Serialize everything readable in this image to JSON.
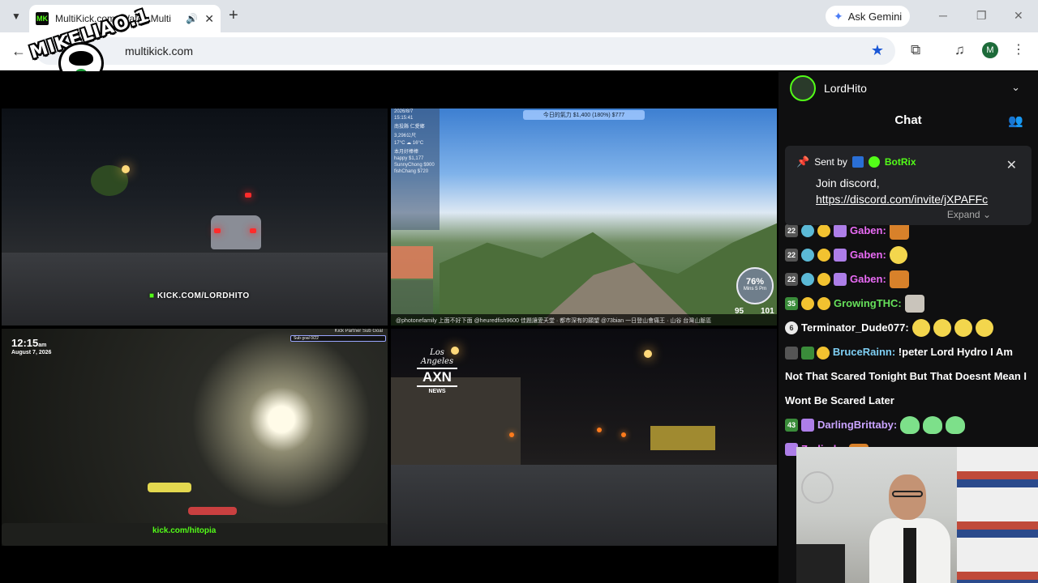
{
  "browser": {
    "tab_title": "MultiKick.com: Watch Multi",
    "tab_favicon": "MK",
    "new_tab": "+",
    "gemini_label": "Ask Gemini",
    "url": "multikick.com",
    "profile_initial": "M"
  },
  "overlay_logo": {
    "text": "MIKELIAO.1"
  },
  "streams": {
    "s1": {
      "watermark": "KICK.COM/LORDHITO"
    },
    "s2": {
      "banner": "今日的氣力   $1,400 (180%)    $777",
      "panel": [
        "2026/8/7",
        "15:15:41",
        "南投縣 仁愛鄉",
        "3,296公尺",
        "17°C ☁ 16°C",
        "本月好棒棒",
        "happy   $1,177",
        "SunnyChong   $900",
        "fishChang   $720"
      ],
      "gauge_pct": "76%",
      "gauge_sub": "Mins 5 Pm",
      "counter_left": "95",
      "counter_right": "101",
      "ticker": "@photonefamily 上面不好下面 @heuredfish9600 佳題讓愛天堂 · 都市深有的願望 @73bian 一日登山會痛王 · 山谷 台灣山脈區"
    },
    "s3": {
      "time": "12:15",
      "ampm": "am",
      "date": "August 7, 2026",
      "subgoal_title": "Kick Partner Sub Goal",
      "subgoal_text": "Sub goal 0/22",
      "watermark": "kick.com/hitopia"
    },
    "s4": {
      "logo_top": "Los Angeles",
      "logo_main": "AXN",
      "logo_bottom": "NEWS"
    }
  },
  "chat": {
    "streamer": "LordHito",
    "title": "Chat",
    "pinned": {
      "sent_by": "Sent by",
      "bot": "BotRix",
      "text": "Join discord,",
      "link": "https://discord.com/invite/jXPAFFc",
      "expand": "Expand"
    },
    "messages": [
      {
        "badge": "22",
        "user": "Gaben:",
        "color": "#e96bf5"
      },
      {
        "badge": "22",
        "user": "Gaben:",
        "color": "#e96bf5"
      },
      {
        "badge": "22",
        "user": "Gaben:",
        "color": "#e96bf5"
      },
      {
        "badge": "35",
        "user": "GrowingTHC:",
        "color": "#66e05a"
      },
      {
        "badge": "6",
        "user": "Terminator_Dude077:",
        "color": "#ffffff"
      },
      {
        "badge": "",
        "user": "BruceRainn:",
        "color": "#7fd0f5",
        "text": "!peter Lord Hydro I Am Not That Scared Tonight But That Doesnt Mean I Wont Be Scared Later"
      },
      {
        "badge": "43",
        "user": "DarlingBrittaby:",
        "color": "#c9a3ff"
      },
      {
        "badge": "",
        "user": "Zerlinda:",
        "color": "#e96bf5"
      }
    ]
  },
  "colors": {
    "kick_green": "#53fc18",
    "chrome_blue": "#1a57d6"
  }
}
